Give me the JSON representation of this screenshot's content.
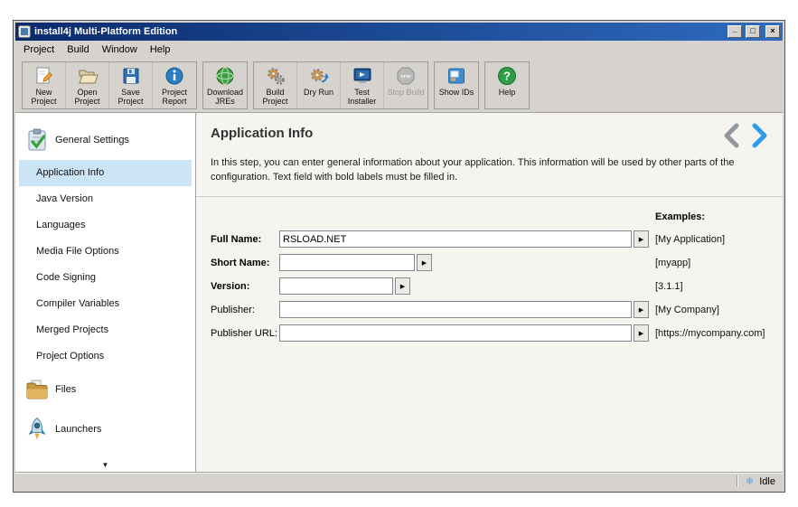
{
  "window": {
    "title": "install4j Multi-Platform Edition",
    "controls": {
      "minimize": "_",
      "maximize": "□",
      "close": "×"
    }
  },
  "menubar": {
    "items": [
      {
        "label": "Project"
      },
      {
        "label": "Build"
      },
      {
        "label": "Window"
      },
      {
        "label": "Help"
      }
    ]
  },
  "toolbar": {
    "groups": [
      {
        "buttons": [
          {
            "label": "New Project",
            "icon": "new-project-icon"
          },
          {
            "label": "Open Project",
            "icon": "open-project-icon"
          },
          {
            "label": "Save Project",
            "icon": "save-project-icon"
          },
          {
            "label": "Project Report",
            "icon": "project-report-icon"
          }
        ]
      },
      {
        "buttons": [
          {
            "label": "Download JREs",
            "icon": "download-jres-icon"
          }
        ]
      },
      {
        "buttons": [
          {
            "label": "Build Project",
            "icon": "build-project-icon"
          },
          {
            "label": "Dry Run",
            "icon": "dry-run-icon"
          },
          {
            "label": "Test Installer",
            "icon": "test-installer-icon"
          },
          {
            "label": "Stop Build",
            "icon": "stop-build-icon",
            "disabled": true
          }
        ]
      },
      {
        "buttons": [
          {
            "label": "Show IDs",
            "icon": "show-ids-icon"
          }
        ]
      },
      {
        "buttons": [
          {
            "label": "Help",
            "icon": "help-icon"
          }
        ]
      }
    ]
  },
  "sidebar": {
    "items": [
      {
        "label": "General Settings",
        "icon": "general-settings-icon",
        "level": "section"
      },
      {
        "label": "Application Info",
        "level": "sub",
        "selected": true
      },
      {
        "label": "Java Version",
        "level": "sub"
      },
      {
        "label": "Languages",
        "level": "sub"
      },
      {
        "label": "Media File Options",
        "level": "sub"
      },
      {
        "label": "Code Signing",
        "level": "sub"
      },
      {
        "label": "Compiler Variables",
        "level": "sub"
      },
      {
        "label": "Merged Projects",
        "level": "sub"
      },
      {
        "label": "Project Options",
        "level": "sub"
      },
      {
        "label": "Files",
        "icon": "files-icon",
        "level": "section"
      },
      {
        "label": "Launchers",
        "icon": "launchers-icon",
        "level": "section"
      }
    ]
  },
  "content": {
    "title": "Application Info",
    "description": "In this step, you can enter general information about your application. This information will be used by other parts of the configuration. Text field with bold labels must be filled in.",
    "examples_label": "Examples:",
    "fields": [
      {
        "label": "Full Name:",
        "value": "RSLOAD.NET",
        "example": "[My Application]",
        "required": true
      },
      {
        "label": "Short Name:",
        "value": "",
        "example": "[myapp]",
        "required": true
      },
      {
        "label": "Version:",
        "value": "",
        "example": "[3.1.1]",
        "required": true
      },
      {
        "label": "Publisher:",
        "value": "",
        "example": "[My Company]",
        "required": false
      },
      {
        "label": "Publisher URL:",
        "value": "",
        "example": "[https://mycompany.com]",
        "required": false
      }
    ]
  },
  "statusbar": {
    "status": "Idle",
    "status_icon": "❄"
  },
  "icons": {
    "field_arrow": "▶",
    "scroll_down": "▼",
    "stop_text": "STOP",
    "help_qmark": "?"
  },
  "colors": {
    "titlebar_start": "#0b2a6b",
    "titlebar_end": "#2f6bbf",
    "selection": "#cbe4f6",
    "accent_blue": "#2e9ce8",
    "chevron_gray": "#8f979c",
    "content_bg": "#f5f4ef",
    "chrome_bg": "#d6d3ce"
  }
}
